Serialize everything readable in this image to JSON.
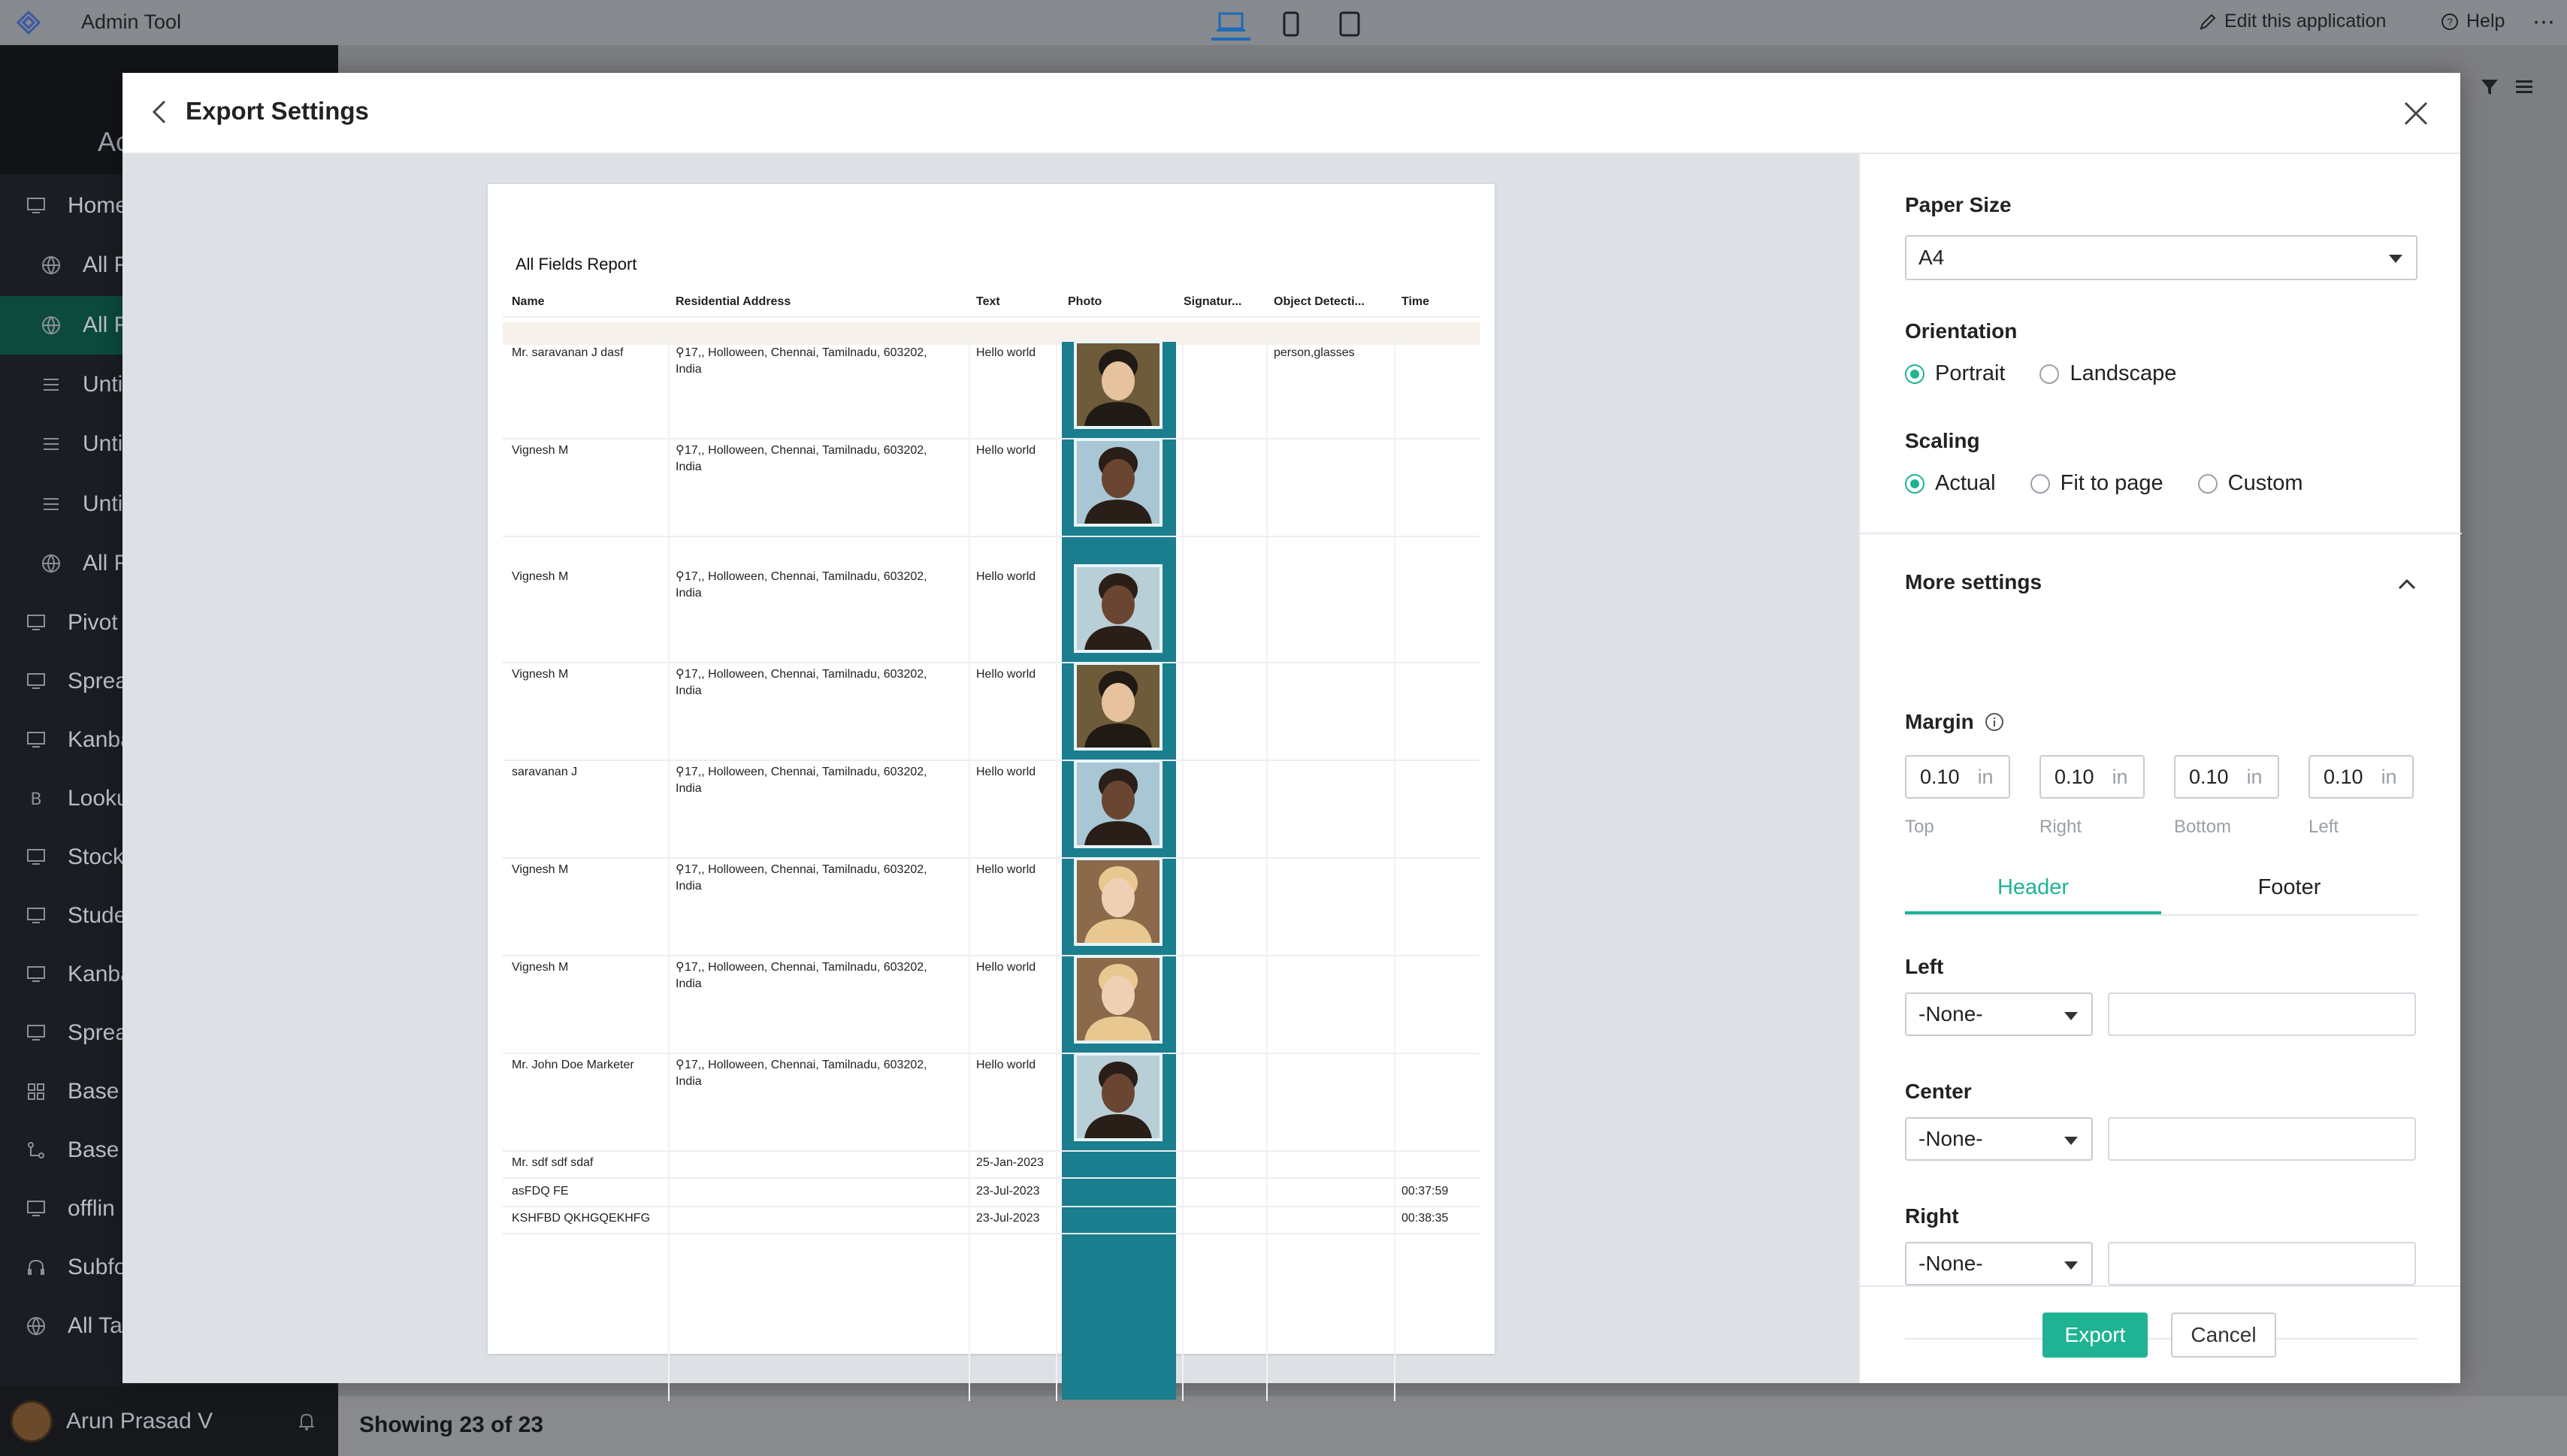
{
  "app": {
    "title": "Admin Tool",
    "edit_label": "Edit this application",
    "help_label": "Help"
  },
  "sidebar": {
    "header_text": "Ac",
    "items": [
      {
        "label": "Home"
      },
      {
        "label": "All F"
      },
      {
        "label": "All F"
      },
      {
        "label": "Unti"
      },
      {
        "label": "Unti"
      },
      {
        "label": "Unti"
      },
      {
        "label": "All F"
      },
      {
        "label": "Pivot"
      },
      {
        "label": "Sprea"
      },
      {
        "label": "Kanba"
      },
      {
        "label": "Looku"
      },
      {
        "label": "Stock"
      },
      {
        "label": "Stude"
      },
      {
        "label": "Kanba"
      },
      {
        "label": "Sprea"
      },
      {
        "label": "Base"
      },
      {
        "label": "Base"
      },
      {
        "label": "offlin"
      },
      {
        "label": "Subfo"
      },
      {
        "label": "All Ta"
      }
    ],
    "user_name": "Arun Prasad V"
  },
  "footer": {
    "showing": "Showing 23 of 23"
  },
  "modal": {
    "title": "Export Settings",
    "report_title": "All Fields Report",
    "columns": [
      "Name",
      "Residential Address",
      "Text",
      "Photo",
      "Signatur...",
      "Object Detecti...",
      "Time"
    ],
    "rows": [
      {
        "name": "Mr. saravanan J dasf",
        "addr1": "17,, Holloween, Chennai, Tamilnadu, 603202,",
        "addr2": "India",
        "text": "Hello world",
        "obj": "person,glasses",
        "time": ""
      },
      {
        "name": "Vignesh M",
        "addr1": "17,, Holloween, Chennai, Tamilnadu, 603202,",
        "addr2": "India",
        "text": "Hello world",
        "obj": "",
        "time": ""
      },
      {
        "name": "Vignesh M",
        "addr1": "17,, Holloween, Chennai, Tamilnadu, 603202,",
        "addr2": "India",
        "text": "Hello world",
        "obj": "",
        "time": ""
      },
      {
        "name": "Vignesh M",
        "addr1": "17,, Holloween, Chennai, Tamilnadu, 603202,",
        "addr2": "India",
        "text": "Hello world",
        "obj": "",
        "time": ""
      },
      {
        "name": "saravanan J",
        "addr1": "17,, Holloween, Chennai, Tamilnadu, 603202,",
        "addr2": "India",
        "text": "Hello world",
        "obj": "",
        "time": ""
      },
      {
        "name": "Vignesh M",
        "addr1": "17,, Holloween, Chennai, Tamilnadu, 603202,",
        "addr2": "India",
        "text": "Hello world",
        "obj": "",
        "time": ""
      },
      {
        "name": "Vignesh M",
        "addr1": "17,, Holloween, Chennai, Tamilnadu, 603202,",
        "addr2": "India",
        "text": "Hello world",
        "obj": "",
        "time": ""
      },
      {
        "name": "Mr. John Doe Marketer",
        "addr1": "17,, Holloween, Chennai, Tamilnadu, 603202,",
        "addr2": "India",
        "text": "Hello world",
        "obj": "",
        "time": ""
      },
      {
        "name": "Mr. sdf sdf sdaf",
        "addr1": "",
        "addr2": "",
        "text": "25-Jan-2023",
        "obj": "",
        "time": ""
      },
      {
        "name": "asFDQ FE",
        "addr1": "",
        "addr2": "",
        "text": "23-Jul-2023",
        "obj": "",
        "time": "00:37:59"
      },
      {
        "name": "KSHFBD QKHGQEKHFG",
        "addr1": "",
        "addr2": "",
        "text": "23-Jul-2023",
        "obj": "",
        "time": "00:38:35"
      }
    ],
    "settings": {
      "paper_size_label": "Paper Size",
      "paper_size_value": "A4",
      "orientation_label": "Orientation",
      "orientation_options": [
        "Portrait",
        "Landscape"
      ],
      "orientation_selected": "Portrait",
      "scaling_label": "Scaling",
      "scaling_options": [
        "Actual",
        "Fit to page",
        "Custom"
      ],
      "scaling_selected": "Actual",
      "more_settings_label": "More settings",
      "margin_label": "Margin",
      "margin_unit": "in",
      "margins": [
        {
          "value": "0.10",
          "label": "Top"
        },
        {
          "value": "0.10",
          "label": "Right"
        },
        {
          "value": "0.10",
          "label": "Bottom"
        },
        {
          "value": "0.10",
          "label": "Left"
        }
      ],
      "tabs": [
        "Header",
        "Footer"
      ],
      "active_tab": "Header",
      "header_fields": [
        {
          "label": "Left",
          "value": "-None-"
        },
        {
          "label": "Center",
          "value": "-None-"
        },
        {
          "label": "Right",
          "value": "-None-"
        }
      ],
      "export_label": "Export",
      "cancel_label": "Cancel"
    }
  },
  "colors": {
    "accent": "#1fb394",
    "photo_band": "#1b7e8f",
    "sidebar_bg": "#1a1d22"
  }
}
